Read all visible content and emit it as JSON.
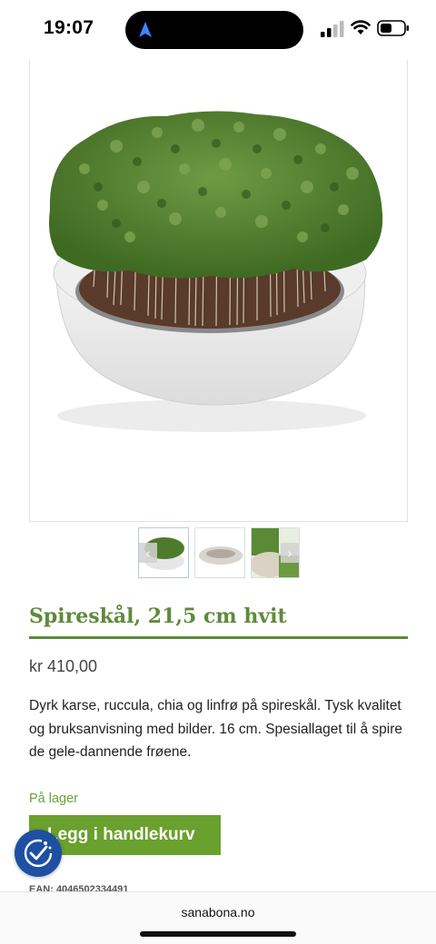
{
  "status_bar": {
    "time": "19:07",
    "icons": [
      "location-arrow-icon",
      "cellular-signal-icon",
      "wifi-icon",
      "battery-icon"
    ]
  },
  "product": {
    "title": "Spireskål, 21,5 cm hvit",
    "price": "kr 410,00",
    "description": "Dyrk karse, ruccula, chia og linfrø på spireskål. Tysk kvalitet og bruksanvisning med bilder. 16 cm. Spesiallaget til å spire de gele-dannende frøene.",
    "stock_status": "På lager",
    "add_to_cart_label": "Legg i handlekurv",
    "ean": "EAN: 4046502334491"
  },
  "gallery": {
    "thumbnails": [
      "cress-bowl-thumbnail",
      "empty-bowl-thumbnail",
      "sprouts-bowl-thumbnail"
    ],
    "active_index": 0
  },
  "browser": {
    "url": "sanabona.no"
  },
  "colors": {
    "accent_green": "#5f8a3a",
    "button_green": "#6aa02e",
    "a11y_blue": "#1e4fa3"
  }
}
